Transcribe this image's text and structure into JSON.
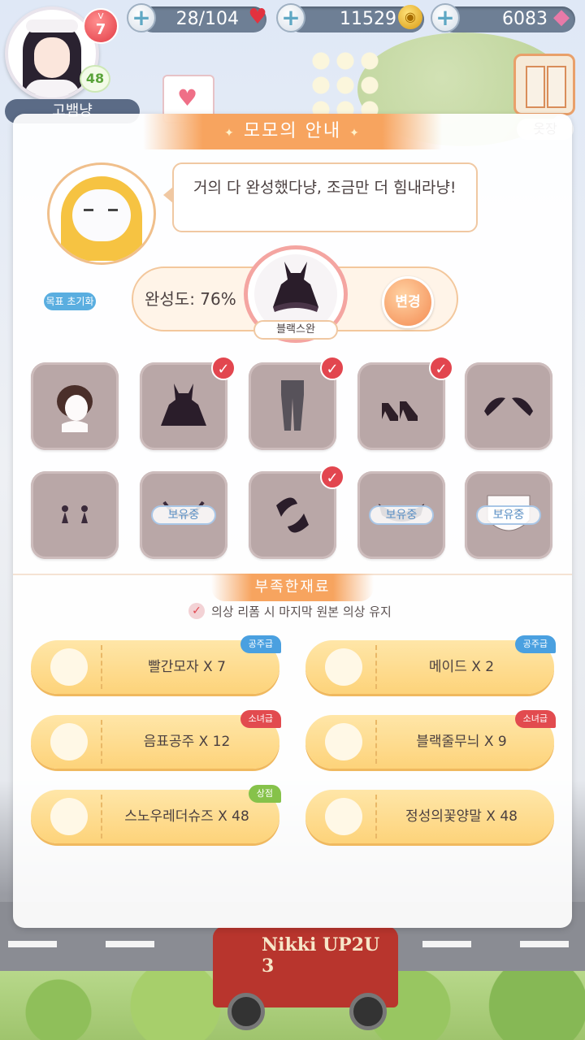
{
  "topbar": {
    "player_name": "고뱀냥",
    "level_prefix": "V",
    "level": "7",
    "sub_level": "48",
    "stamina": "28/104",
    "coins": "11529",
    "diamonds": "6083",
    "wardrobe_label": "옷장",
    "diary_label": "Nikki"
  },
  "panel": {
    "title": "모모의 안내",
    "momo_message": "거의 다 완성했다냥, 조금만 더 힘내라냥!",
    "progress_text": "완성도: 76%",
    "reset_button": "목표 초기화",
    "target_name": "블랙스완",
    "change_button": "변경",
    "owned_label": "보유중",
    "materials_title": "부족한재료",
    "keep_option": "의상 리폼 시 마지막 원본 의상 유지"
  },
  "items": [
    {
      "name": "hair",
      "checked": false,
      "owned": false
    },
    {
      "name": "dress",
      "checked": true,
      "owned": false
    },
    {
      "name": "socks",
      "checked": true,
      "owned": false
    },
    {
      "name": "shoes",
      "checked": true,
      "owned": false
    },
    {
      "name": "hair-accessory",
      "checked": false,
      "owned": false
    },
    {
      "name": "earrings",
      "checked": false,
      "owned": false
    },
    {
      "name": "necklace",
      "checked": false,
      "owned": true
    },
    {
      "name": "bracelet",
      "checked": true,
      "owned": false
    },
    {
      "name": "headpiece",
      "checked": false,
      "owned": true
    },
    {
      "name": "makeup",
      "checked": false,
      "owned": true
    }
  ],
  "materials": [
    {
      "name": "빨간모자 X 7",
      "tag": "공주급",
      "tag_color": "#4aa0e0"
    },
    {
      "name": "메이드 X 2",
      "tag": "공주급",
      "tag_color": "#4aa0e0"
    },
    {
      "name": "음표공주 X 12",
      "tag": "소녀급",
      "tag_color": "#e24b4f"
    },
    {
      "name": "블랙줄무늬 X 9",
      "tag": "소녀급",
      "tag_color": "#e24b4f"
    },
    {
      "name": "스노우레더슈즈 X 48",
      "tag": "상점",
      "tag_color": "#86c24a"
    },
    {
      "name": "정성의꽃양말 X 48",
      "tag": "",
      "tag_color": ""
    }
  ],
  "background": {
    "bus_text": "Nikki UP2U 3"
  },
  "colors": {
    "accent_orange": "#f7a45f",
    "check_red": "#e2464f",
    "card_yellow": "#fdd37a"
  }
}
